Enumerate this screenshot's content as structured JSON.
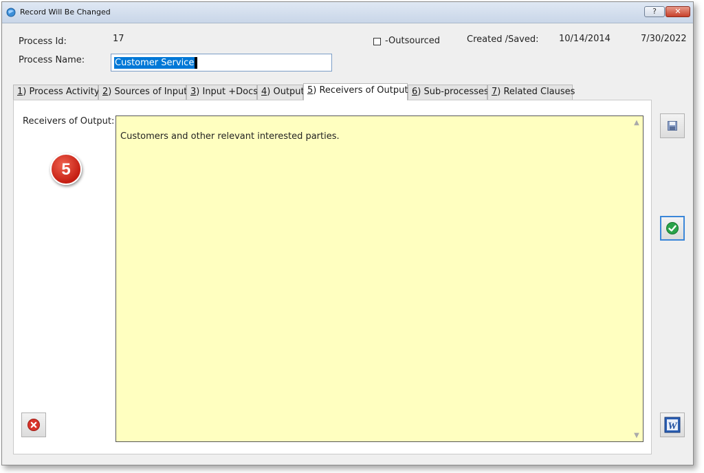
{
  "window": {
    "title": "Record Will Be Changed",
    "help_glyph": "?",
    "close_glyph": "✕"
  },
  "header": {
    "process_id_label": "Process Id:",
    "process_id_value": "17",
    "process_name_label": "Process Name:",
    "process_name_value": "Customer Service",
    "outsourced_label": "-Outsourced",
    "outsourced_checked": false,
    "created_saved_label": "Created /Saved:",
    "created_date": "10/14/2014",
    "saved_date": "7/30/2022"
  },
  "tabs": [
    {
      "key": "1",
      "label": ") Process Activity",
      "active": false
    },
    {
      "key": "2",
      "label": ") Sources of Input",
      "active": false
    },
    {
      "key": "3",
      "label": ") Input +Docs",
      "active": false
    },
    {
      "key": "4",
      "label": ") Output",
      "active": false
    },
    {
      "key": "5",
      "label": ") Receivers of Output",
      "active": true
    },
    {
      "key": "6",
      "label": ") Sub-processes",
      "active": false
    },
    {
      "key": "7",
      "label": ") Related Clauses",
      "active": false
    }
  ],
  "content": {
    "field_label": "Receivers of Output:",
    "memo_text": "Customers and other relevant interested parties.",
    "step_badge": "5",
    "memo_color": "#ffffc0"
  },
  "buttons": {
    "save_icon": "floppy-disk-icon",
    "confirm_icon": "green-checkmark-icon",
    "cancel_icon": "red-x-icon",
    "word_icon": "word-document-icon",
    "word_letter": "W"
  }
}
